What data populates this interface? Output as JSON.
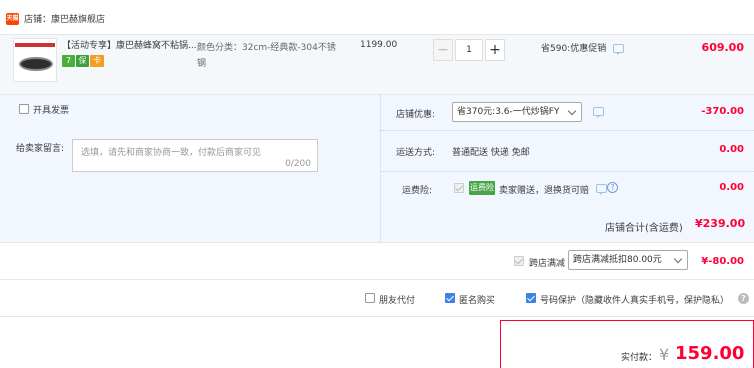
{
  "shop": {
    "badge": "天猫",
    "label": "店铺：康巴赫旗舰店"
  },
  "item": {
    "title": "【活动专享】康巴赫蜂窝不粘锅...",
    "tags": [
      "7",
      "保",
      "卡"
    ],
    "spec": "颜色分类：32cm-经典款-304不锈钢",
    "price": "1199.00",
    "quantity": "1",
    "promo": "省590:优惠促销",
    "subtotal": "609.00"
  },
  "options": {
    "invoice_label": "开具发票",
    "message_label": "给卖家留言:",
    "message_placeholder": "选填，请先和商家协商一致，付款后商家可见",
    "message_count": "0/200",
    "shop_coupon_label": "店铺优惠:",
    "shop_coupon_select": "省370元:3.6-一代炒锅FY",
    "shop_coupon_value": "-370.00",
    "delivery_label": "运送方式:",
    "delivery_value": "普通配送 快递 免邮",
    "delivery_amount": "0.00",
    "insurance_label": "运费险:",
    "insurance_badge": "运费险",
    "insurance_text": "卖家赠送，退换货可赔",
    "insurance_amount": "0.00",
    "shop_total_label": "店铺合计(含运费)",
    "shop_total_value": "¥239.00"
  },
  "cross_store": {
    "label": "跨店满减",
    "select": "跨店满减抵扣80.00元",
    "value": "¥-80.00"
  },
  "privacy": {
    "friend_pay": "朋友代付",
    "anonymous": "匿名购买",
    "number_protect": "号码保护（隐藏收件人真实手机号，保护隐私）"
  },
  "pay": {
    "label": "实付款：",
    "currency": "¥",
    "value": "159.00"
  },
  "colors": {
    "accent_red": "#ff0036",
    "brand_orange": "#ff4400",
    "blue_check": "#3d83e6",
    "panel_bg": "#f2f7ff"
  }
}
